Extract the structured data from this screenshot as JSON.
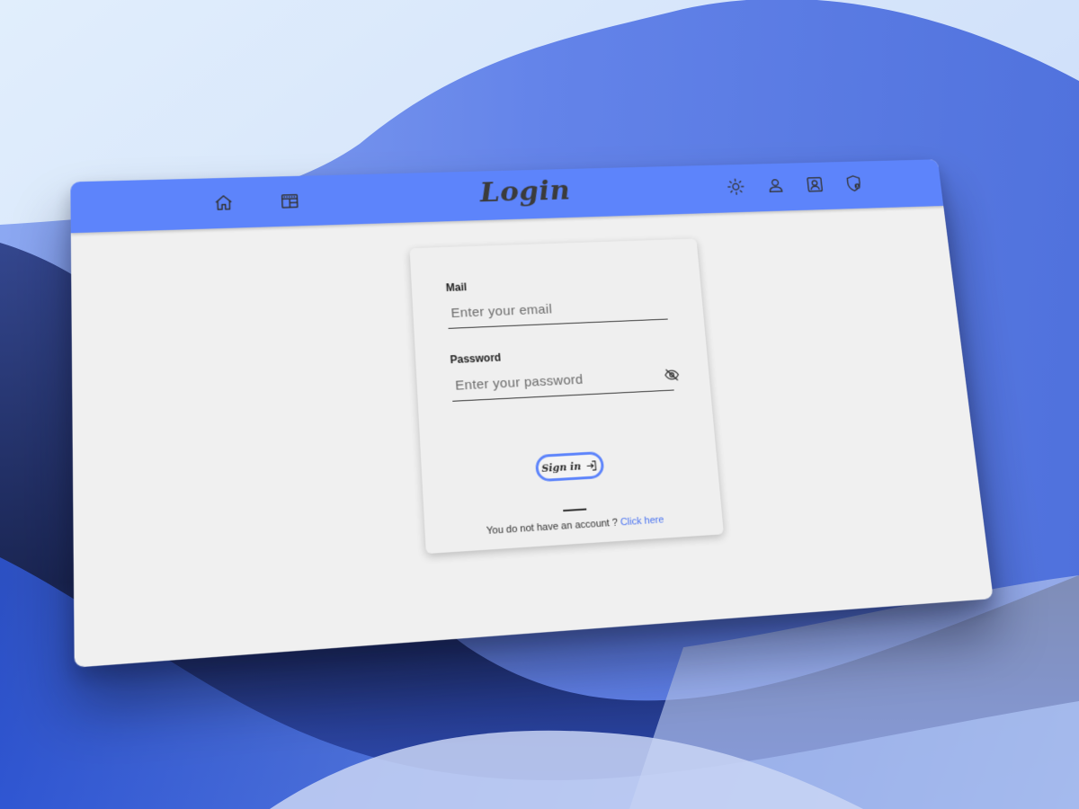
{
  "window": {
    "title": "Login"
  },
  "header": {
    "left_icons": [
      "home-icon",
      "layout-icon"
    ],
    "right_icons": [
      "sun-icon",
      "user-icon",
      "contact-icon",
      "shield-user-icon"
    ]
  },
  "form": {
    "mail": {
      "label": "Mail",
      "placeholder": "Enter your email",
      "value": ""
    },
    "password": {
      "label": "Password",
      "placeholder": "Enter your password",
      "value": "",
      "visibility_icon": "eye-off-icon"
    },
    "submit": {
      "label": "Sign in",
      "icon": "sign-in-arrow-icon"
    },
    "signup": {
      "text": "You do not have an account ? ",
      "link": "Click here"
    }
  },
  "colors": {
    "accent": "#5d84fb",
    "background": "#f0f0f0",
    "link": "#4a73f0"
  }
}
